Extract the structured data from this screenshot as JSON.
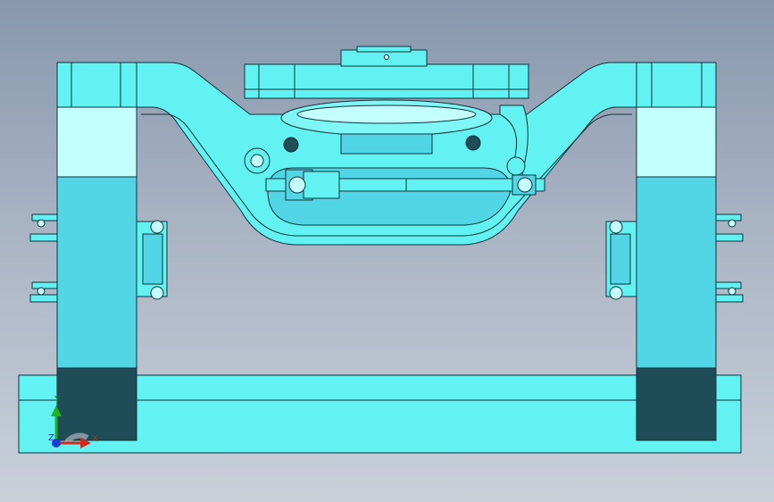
{
  "viewport": {
    "background_top": "#8797ad",
    "background_bottom": "#c9d0da"
  },
  "colors": {
    "part_fill": "#62f2f2",
    "part_light": "#c4ffff",
    "part_mid": "#52d6e6",
    "part_dark": "#1e4d58",
    "edge": "#12323a"
  },
  "triad": {
    "x_label": "X",
    "y_label": "Y",
    "z_label": "Z",
    "x_color": "#d8261a",
    "y_color": "#1fb51f",
    "z_color": "#1a3fd8"
  }
}
